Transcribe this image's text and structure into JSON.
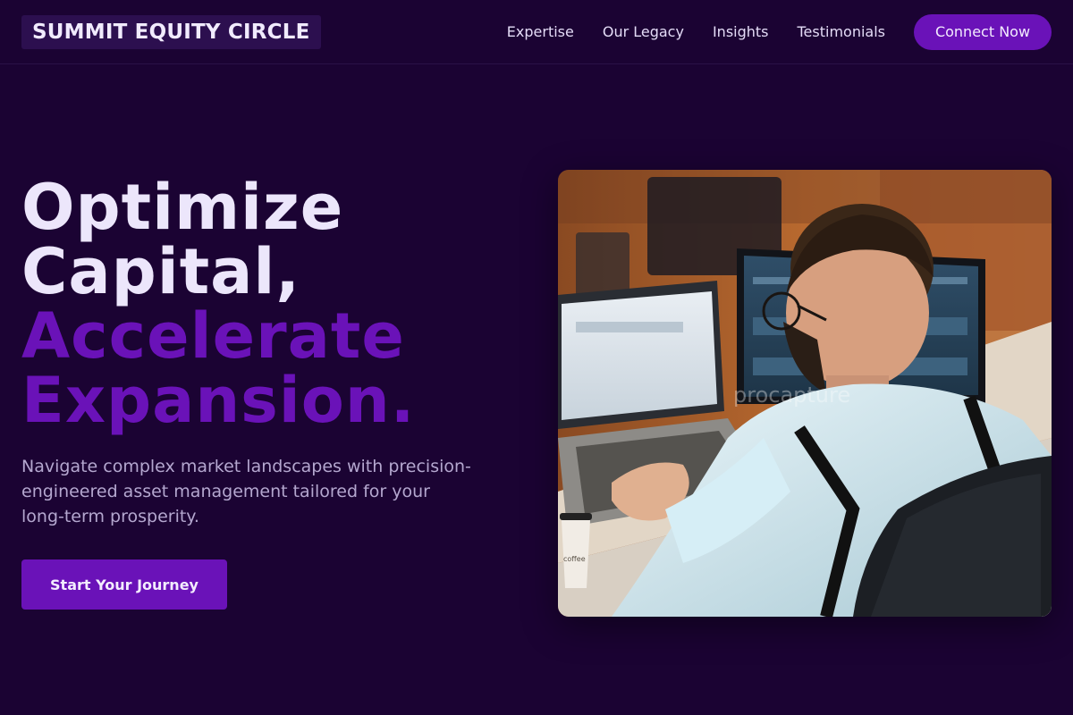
{
  "header": {
    "logo": "SUMMIT EQUITY CIRCLE",
    "nav": [
      "Expertise",
      "Our Legacy",
      "Insights",
      "Testimonials"
    ],
    "cta": "Connect Now"
  },
  "hero": {
    "headline_1": "Optimize",
    "headline_2": "Capital,",
    "headline_3": "Accelerate",
    "headline_4": "Expansion.",
    "subtitle": "Navigate complex market landscapes with precision-engineered asset management tailored for your long-term prosperity.",
    "button": "Start Your Journey"
  },
  "photo": {
    "watermark": "procapture",
    "cup_text": "coffee"
  },
  "colors": {
    "background": "#1b0333",
    "accent": "#6a12b8",
    "text": "#ece6fb",
    "muted": "#b4a7cf"
  }
}
